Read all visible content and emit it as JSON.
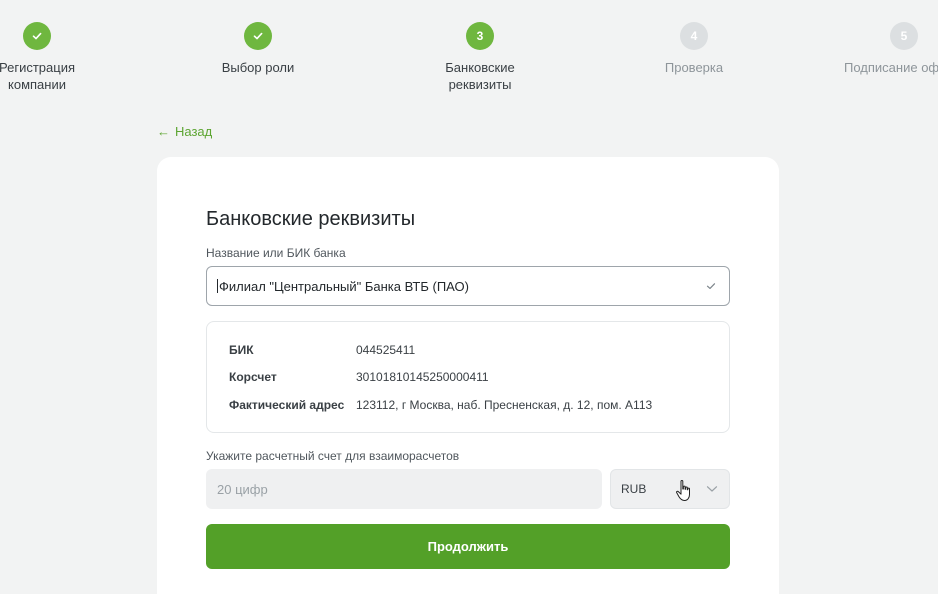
{
  "stepper": {
    "steps": [
      {
        "number": "",
        "label_line1": "Регистрация",
        "label_line2": "компании",
        "state": "done"
      },
      {
        "number": "",
        "label_line1": "Выбор роли",
        "label_line2": "",
        "state": "done"
      },
      {
        "number": "3",
        "label_line1": "Банковские",
        "label_line2": "реквизиты",
        "state": "active"
      },
      {
        "number": "4",
        "label_line1": "Проверка",
        "label_line2": "",
        "state": "pending"
      },
      {
        "number": "5",
        "label_line1": "Подписание офе",
        "label_line2": "",
        "state": "pending"
      }
    ]
  },
  "back_link": {
    "label": "Назад"
  },
  "form": {
    "title": "Банковские реквизиты",
    "bank_field": {
      "label": "Название или БИК банка",
      "value": "Филиал \"Центральный\" Банка ВТБ (ПАО)"
    },
    "bank_info": [
      {
        "key": "БИК",
        "value": "044525411"
      },
      {
        "key": "Корсчет",
        "value": "30101810145250000411"
      },
      {
        "key": "Фактический адрес",
        "value": "123112, г Москва, наб. Пресненская, д. 12, пом. А113"
      }
    ],
    "account_field": {
      "label": "Укажите расчетный счет для взаиморасчетов",
      "placeholder": "20 цифр",
      "value": ""
    },
    "currency": {
      "selected": "RUB"
    },
    "submit_label": "Продолжить"
  },
  "colors": {
    "accent": "#6fb73f",
    "button": "#53a028",
    "pending": "#dcdfe1",
    "background": "#f2f3f3"
  }
}
